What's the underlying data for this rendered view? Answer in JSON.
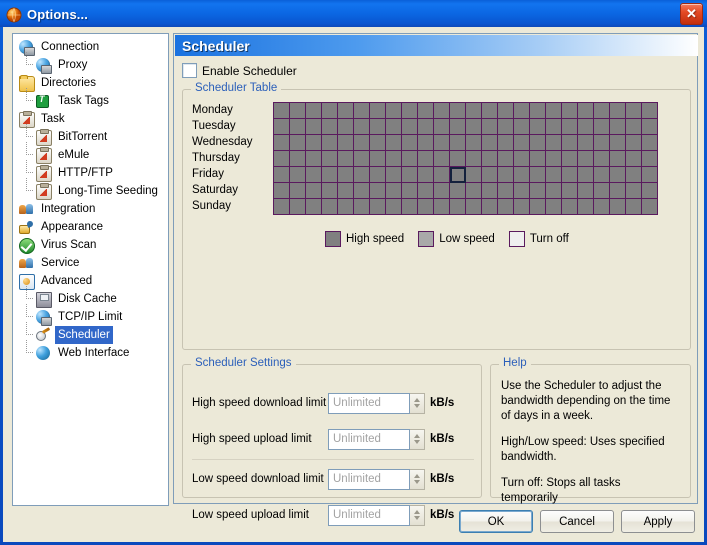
{
  "window": {
    "title": "Options...",
    "icon": "app-orange-globe-icon",
    "close_label": "✕"
  },
  "sidebar": {
    "items": [
      {
        "label": "Connection",
        "icon": "globe-network-icon",
        "level": 0,
        "selected": false
      },
      {
        "label": "Proxy",
        "icon": "globe-proxy-icon",
        "level": 1,
        "selected": false
      },
      {
        "label": "Directories",
        "icon": "folder-icon",
        "level": 0,
        "selected": false
      },
      {
        "label": "Task Tags",
        "icon": "tag-icon",
        "level": 1,
        "selected": false
      },
      {
        "label": "Task",
        "icon": "clipboard-icon",
        "level": 0,
        "selected": false
      },
      {
        "label": "BitTorrent",
        "icon": "clipboard-icon",
        "level": 1,
        "selected": false
      },
      {
        "label": "eMule",
        "icon": "clipboard-icon",
        "level": 1,
        "selected": false
      },
      {
        "label": "HTTP/FTP",
        "icon": "clipboard-icon",
        "level": 1,
        "selected": false
      },
      {
        "label": "Long-Time Seeding",
        "icon": "clipboard-icon",
        "level": 1,
        "selected": false
      },
      {
        "label": "Integration",
        "icon": "people-icon",
        "level": 0,
        "selected": false
      },
      {
        "label": "Appearance",
        "icon": "paintbrush-icon",
        "level": 0,
        "selected": false
      },
      {
        "label": "Virus Scan",
        "icon": "shield-check-icon",
        "level": 0,
        "selected": false
      },
      {
        "label": "Service",
        "icon": "people-icon",
        "level": 0,
        "selected": false
      },
      {
        "label": "Advanced",
        "icon": "advanced-icon",
        "level": 0,
        "selected": false
      },
      {
        "label": "Disk Cache",
        "icon": "disk-icon",
        "level": 1,
        "selected": false
      },
      {
        "label": "TCP/IP Limit",
        "icon": "globe-network-icon",
        "level": 1,
        "selected": false
      },
      {
        "label": "Scheduler",
        "icon": "scheduler-icon",
        "level": 1,
        "selected": true
      },
      {
        "label": "Web Interface",
        "icon": "globe-web-icon",
        "level": 1,
        "selected": false
      }
    ]
  },
  "pane": {
    "title": "Scheduler",
    "enable_checkbox": {
      "label": "Enable Scheduler",
      "checked": false
    }
  },
  "scheduler_table": {
    "caption": "Scheduler Table",
    "days": [
      "Monday",
      "Tuesday",
      "Wednesday",
      "Thursday",
      "Friday",
      "Saturday",
      "Sunday"
    ],
    "hours": 24,
    "default_state": "high",
    "cursor": {
      "day": "Friday",
      "day_index": 4,
      "hour_index": 11
    },
    "legend": [
      {
        "label": "High speed",
        "color": "#808080"
      },
      {
        "label": "Low speed",
        "color": "#a9a9a9"
      },
      {
        "label": "Turn off",
        "color": "#efefef"
      }
    ],
    "grid_border_color": "#5a1a5e"
  },
  "settings": {
    "caption": "Scheduler Settings",
    "unit": "kB/s",
    "fields": [
      {
        "label": "High speed download limit",
        "value": "",
        "placeholder": "Unlimited"
      },
      {
        "label": "High speed upload limit",
        "value": "",
        "placeholder": "Unlimited"
      },
      {
        "label": "Low speed download limit",
        "value": "",
        "placeholder": "Unlimited"
      },
      {
        "label": "Low speed upload limit",
        "value": "",
        "placeholder": "Unlimited"
      }
    ]
  },
  "help": {
    "caption": "Help",
    "paragraphs": [
      "Use the Scheduler to adjust the bandwidth depending on the time of days in a week.",
      "High/Low speed: Uses specified bandwidth.",
      "Turn off: Stops all tasks temporarily"
    ]
  },
  "buttons": {
    "ok": "OK",
    "cancel": "Cancel",
    "apply": "Apply"
  }
}
